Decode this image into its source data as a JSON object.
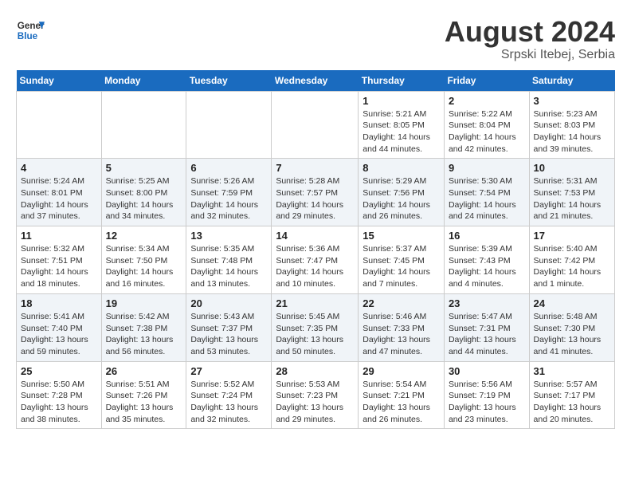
{
  "header": {
    "logo_line1": "General",
    "logo_line2": "Blue",
    "month_year": "August 2024",
    "location": "Srpski Itebej, Serbia"
  },
  "weekdays": [
    "Sunday",
    "Monday",
    "Tuesday",
    "Wednesday",
    "Thursday",
    "Friday",
    "Saturday"
  ],
  "weeks": [
    [
      {
        "day": "",
        "info": ""
      },
      {
        "day": "",
        "info": ""
      },
      {
        "day": "",
        "info": ""
      },
      {
        "day": "",
        "info": ""
      },
      {
        "day": "1",
        "info": "Sunrise: 5:21 AM\nSunset: 8:05 PM\nDaylight: 14 hours and 44 minutes."
      },
      {
        "day": "2",
        "info": "Sunrise: 5:22 AM\nSunset: 8:04 PM\nDaylight: 14 hours and 42 minutes."
      },
      {
        "day": "3",
        "info": "Sunrise: 5:23 AM\nSunset: 8:03 PM\nDaylight: 14 hours and 39 minutes."
      }
    ],
    [
      {
        "day": "4",
        "info": "Sunrise: 5:24 AM\nSunset: 8:01 PM\nDaylight: 14 hours and 37 minutes."
      },
      {
        "day": "5",
        "info": "Sunrise: 5:25 AM\nSunset: 8:00 PM\nDaylight: 14 hours and 34 minutes."
      },
      {
        "day": "6",
        "info": "Sunrise: 5:26 AM\nSunset: 7:59 PM\nDaylight: 14 hours and 32 minutes."
      },
      {
        "day": "7",
        "info": "Sunrise: 5:28 AM\nSunset: 7:57 PM\nDaylight: 14 hours and 29 minutes."
      },
      {
        "day": "8",
        "info": "Sunrise: 5:29 AM\nSunset: 7:56 PM\nDaylight: 14 hours and 26 minutes."
      },
      {
        "day": "9",
        "info": "Sunrise: 5:30 AM\nSunset: 7:54 PM\nDaylight: 14 hours and 24 minutes."
      },
      {
        "day": "10",
        "info": "Sunrise: 5:31 AM\nSunset: 7:53 PM\nDaylight: 14 hours and 21 minutes."
      }
    ],
    [
      {
        "day": "11",
        "info": "Sunrise: 5:32 AM\nSunset: 7:51 PM\nDaylight: 14 hours and 18 minutes."
      },
      {
        "day": "12",
        "info": "Sunrise: 5:34 AM\nSunset: 7:50 PM\nDaylight: 14 hours and 16 minutes."
      },
      {
        "day": "13",
        "info": "Sunrise: 5:35 AM\nSunset: 7:48 PM\nDaylight: 14 hours and 13 minutes."
      },
      {
        "day": "14",
        "info": "Sunrise: 5:36 AM\nSunset: 7:47 PM\nDaylight: 14 hours and 10 minutes."
      },
      {
        "day": "15",
        "info": "Sunrise: 5:37 AM\nSunset: 7:45 PM\nDaylight: 14 hours and 7 minutes."
      },
      {
        "day": "16",
        "info": "Sunrise: 5:39 AM\nSunset: 7:43 PM\nDaylight: 14 hours and 4 minutes."
      },
      {
        "day": "17",
        "info": "Sunrise: 5:40 AM\nSunset: 7:42 PM\nDaylight: 14 hours and 1 minute."
      }
    ],
    [
      {
        "day": "18",
        "info": "Sunrise: 5:41 AM\nSunset: 7:40 PM\nDaylight: 13 hours and 59 minutes."
      },
      {
        "day": "19",
        "info": "Sunrise: 5:42 AM\nSunset: 7:38 PM\nDaylight: 13 hours and 56 minutes."
      },
      {
        "day": "20",
        "info": "Sunrise: 5:43 AM\nSunset: 7:37 PM\nDaylight: 13 hours and 53 minutes."
      },
      {
        "day": "21",
        "info": "Sunrise: 5:45 AM\nSunset: 7:35 PM\nDaylight: 13 hours and 50 minutes."
      },
      {
        "day": "22",
        "info": "Sunrise: 5:46 AM\nSunset: 7:33 PM\nDaylight: 13 hours and 47 minutes."
      },
      {
        "day": "23",
        "info": "Sunrise: 5:47 AM\nSunset: 7:31 PM\nDaylight: 13 hours and 44 minutes."
      },
      {
        "day": "24",
        "info": "Sunrise: 5:48 AM\nSunset: 7:30 PM\nDaylight: 13 hours and 41 minutes."
      }
    ],
    [
      {
        "day": "25",
        "info": "Sunrise: 5:50 AM\nSunset: 7:28 PM\nDaylight: 13 hours and 38 minutes."
      },
      {
        "day": "26",
        "info": "Sunrise: 5:51 AM\nSunset: 7:26 PM\nDaylight: 13 hours and 35 minutes."
      },
      {
        "day": "27",
        "info": "Sunrise: 5:52 AM\nSunset: 7:24 PM\nDaylight: 13 hours and 32 minutes."
      },
      {
        "day": "28",
        "info": "Sunrise: 5:53 AM\nSunset: 7:23 PM\nDaylight: 13 hours and 29 minutes."
      },
      {
        "day": "29",
        "info": "Sunrise: 5:54 AM\nSunset: 7:21 PM\nDaylight: 13 hours and 26 minutes."
      },
      {
        "day": "30",
        "info": "Sunrise: 5:56 AM\nSunset: 7:19 PM\nDaylight: 13 hours and 23 minutes."
      },
      {
        "day": "31",
        "info": "Sunrise: 5:57 AM\nSunset: 7:17 PM\nDaylight: 13 hours and 20 minutes."
      }
    ]
  ]
}
